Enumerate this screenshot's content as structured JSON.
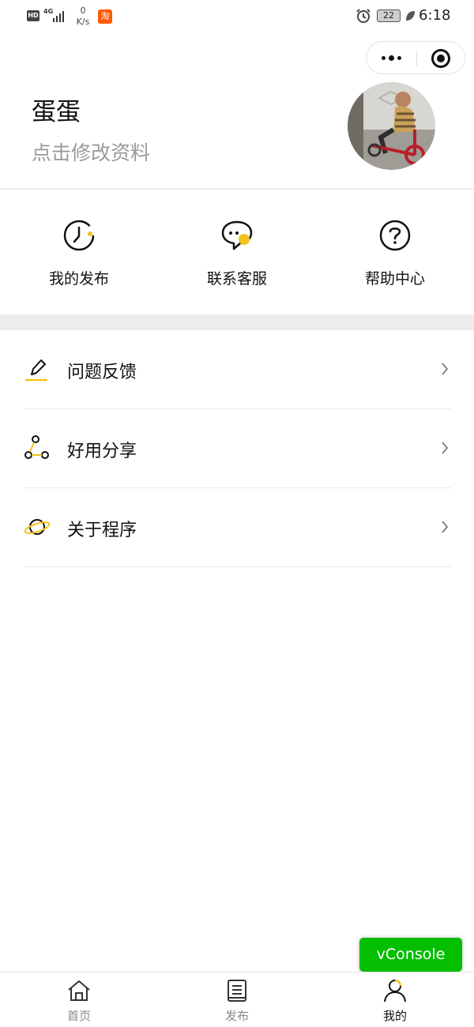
{
  "status_bar": {
    "hd": "HD",
    "network": "4G",
    "speed_value": "0",
    "speed_unit": "K/s",
    "taobao": "淘",
    "battery": "22",
    "time": "6:18"
  },
  "profile": {
    "name": "蛋蛋",
    "edit_label": "点击修改资料"
  },
  "shortcuts": [
    {
      "label": "我的发布",
      "icon": "clock-icon"
    },
    {
      "label": "联系客服",
      "icon": "chat-icon"
    },
    {
      "label": "帮助中心",
      "icon": "help-icon"
    }
  ],
  "menu": [
    {
      "label": "问题反馈",
      "icon": "pencil-icon"
    },
    {
      "label": "好用分享",
      "icon": "share-icon"
    },
    {
      "label": "关于程序",
      "icon": "planet-icon"
    }
  ],
  "vconsole_label": "vConsole",
  "tabs": [
    {
      "label": "首页",
      "icon": "home-icon",
      "active": false
    },
    {
      "label": "发布",
      "icon": "document-icon",
      "active": false
    },
    {
      "label": "我的",
      "icon": "user-icon",
      "active": true
    }
  ],
  "colors": {
    "accent": "#f5c21b",
    "vconsole": "#04be02",
    "text_secondary": "#9a9a9a",
    "divider": "#ededed"
  }
}
